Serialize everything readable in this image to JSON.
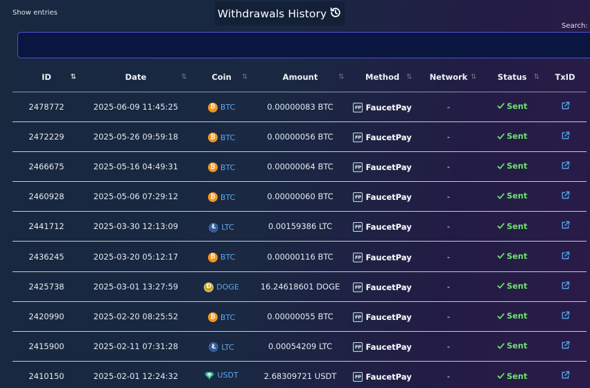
{
  "controls": {
    "show_entries_label": "Show entries",
    "search_label": "Search:",
    "search_value": ""
  },
  "header": {
    "title": "Withdrawals History"
  },
  "table": {
    "columns": [
      "ID",
      "Date",
      "Coin",
      "Amount",
      "Method",
      "Network",
      "Status",
      "TxID"
    ],
    "rows": [
      {
        "id": "2478772",
        "date": "2025-06-09 11:45:25",
        "coin": "BTC",
        "coin_icon": "bitcoin-icon",
        "amount": "0.00000083 BTC",
        "method": "FaucetPay",
        "network": "-",
        "status": "Sent"
      },
      {
        "id": "2472229",
        "date": "2025-05-26 09:59:18",
        "coin": "BTC",
        "coin_icon": "bitcoin-icon",
        "amount": "0.00000056 BTC",
        "method": "FaucetPay",
        "network": "-",
        "status": "Sent"
      },
      {
        "id": "2466675",
        "date": "2025-05-16 04:49:31",
        "coin": "BTC",
        "coin_icon": "bitcoin-icon",
        "amount": "0.00000064 BTC",
        "method": "FaucetPay",
        "network": "-",
        "status": "Sent"
      },
      {
        "id": "2460928",
        "date": "2025-05-06 07:29:12",
        "coin": "BTC",
        "coin_icon": "bitcoin-icon",
        "amount": "0.00000060 BTC",
        "method": "FaucetPay",
        "network": "-",
        "status": "Sent"
      },
      {
        "id": "2441712",
        "date": "2025-03-30 12:13:09",
        "coin": "LTC",
        "coin_icon": "litecoin-icon",
        "amount": "0.00159386 LTC",
        "method": "FaucetPay",
        "network": "-",
        "status": "Sent"
      },
      {
        "id": "2436245",
        "date": "2025-03-20 05:12:17",
        "coin": "BTC",
        "coin_icon": "bitcoin-icon",
        "amount": "0.00000116 BTC",
        "method": "FaucetPay",
        "network": "-",
        "status": "Sent"
      },
      {
        "id": "2425738",
        "date": "2025-03-01 13:27:59",
        "coin": "DOGE",
        "coin_icon": "dogecoin-icon",
        "amount": "16.24618601 DOGE",
        "method": "FaucetPay",
        "network": "-",
        "status": "Sent"
      },
      {
        "id": "2420990",
        "date": "2025-02-20 08:25:52",
        "coin": "BTC",
        "coin_icon": "bitcoin-icon",
        "amount": "0.00000055 BTC",
        "method": "FaucetPay",
        "network": "-",
        "status": "Sent"
      },
      {
        "id": "2415900",
        "date": "2025-02-11 07:31:28",
        "coin": "LTC",
        "coin_icon": "litecoin-icon",
        "amount": "0.00054209 LTC",
        "method": "FaucetPay",
        "network": "-",
        "status": "Sent"
      },
      {
        "id": "2410150",
        "date": "2025-02-01 12:24:32",
        "coin": "USDT",
        "coin_icon": "tether-icon",
        "amount": "2.68309721 USDT",
        "method": "FaucetPay",
        "network": "-",
        "status": "Sent"
      }
    ]
  },
  "colors": {
    "coin_link": "#5da9ea",
    "status_sent": "#6be36b",
    "external_link": "#4fa3e6",
    "search_border": "#4a55d8"
  }
}
